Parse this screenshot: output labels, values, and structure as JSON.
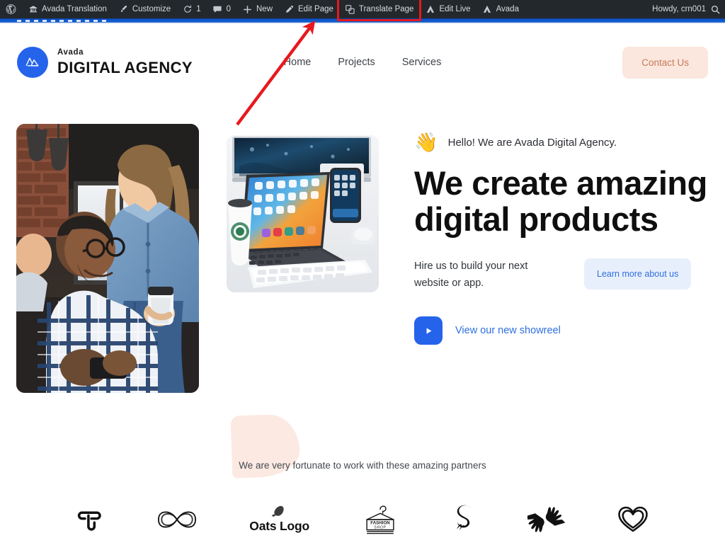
{
  "admin_bar": {
    "items": [
      {
        "icon": "wordpress-icon",
        "label": ""
      },
      {
        "icon": "avada-translation-icon",
        "label": "Avada Translation"
      },
      {
        "icon": "brush-icon",
        "label": "Customize"
      },
      {
        "icon": "updates-icon",
        "label": "1"
      },
      {
        "icon": "comments-icon",
        "label": "0"
      },
      {
        "icon": "plus-icon",
        "label": "New"
      },
      {
        "icon": "pencil-icon",
        "label": "Edit Page"
      },
      {
        "icon": "translate-icon",
        "label": "Translate Page"
      },
      {
        "icon": "avada-icon",
        "label": "Edit Live"
      },
      {
        "icon": "avada-icon",
        "label": "Avada"
      }
    ],
    "highlighted_item": "Translate Page",
    "howdy": "Howdy, crn001",
    "search_icon": "search-icon",
    "highlight_color": "#e8181c",
    "background": "#23282d"
  },
  "site_header": {
    "logo": {
      "mark_icon": "avada-mountain-logo-icon",
      "mark_color": "#2563eb",
      "small_text": "Avada",
      "big_text": "DIGITAL AGENCY"
    },
    "nav": [
      {
        "label": "Home"
      },
      {
        "label": "Projects"
      },
      {
        "label": "Services"
      }
    ],
    "cta": {
      "label": "Contact Us",
      "bg": "#fbe7dd",
      "color": "#c87a5b"
    }
  },
  "hero": {
    "photo_people_alt": "two colleagues talking in office",
    "photo_desk_alt": "tablet phone monitor and keyboard on desk",
    "hello": {
      "emoji": "👋",
      "text": "Hello! We are Avada Digital Agency."
    },
    "headline": "We create amazing digital products",
    "subcopy": "Hire us to build your next website or app.",
    "learn_more": {
      "label": "Learn more about us",
      "bg": "#e8effc",
      "color": "#2f6fe0"
    },
    "showreel": {
      "label": "View our new showreel",
      "icon": "play-icon",
      "button_color": "#2563eb",
      "text_color": "#2f6fe0"
    }
  },
  "partners": {
    "title": "We are very fortunate to work with these amazing partners",
    "logos": [
      {
        "name": "t-monogram-logo-icon",
        "label": ""
      },
      {
        "name": "infinity-logo-icon",
        "label": ""
      },
      {
        "name": "oats-logo-icon",
        "label": "Oats Logo"
      },
      {
        "name": "fashion-shop-hanger-logo-icon",
        "label": "FASHION",
        "sublabel": "SHOP"
      },
      {
        "name": "s-script-logo-icon",
        "label": ""
      },
      {
        "name": "hands-logo-icon",
        "label": ""
      },
      {
        "name": "heart-logo-icon",
        "label": ""
      }
    ]
  },
  "annotation": {
    "type": "arrow",
    "color": "#e8181c",
    "points_to": "Translate Page"
  }
}
